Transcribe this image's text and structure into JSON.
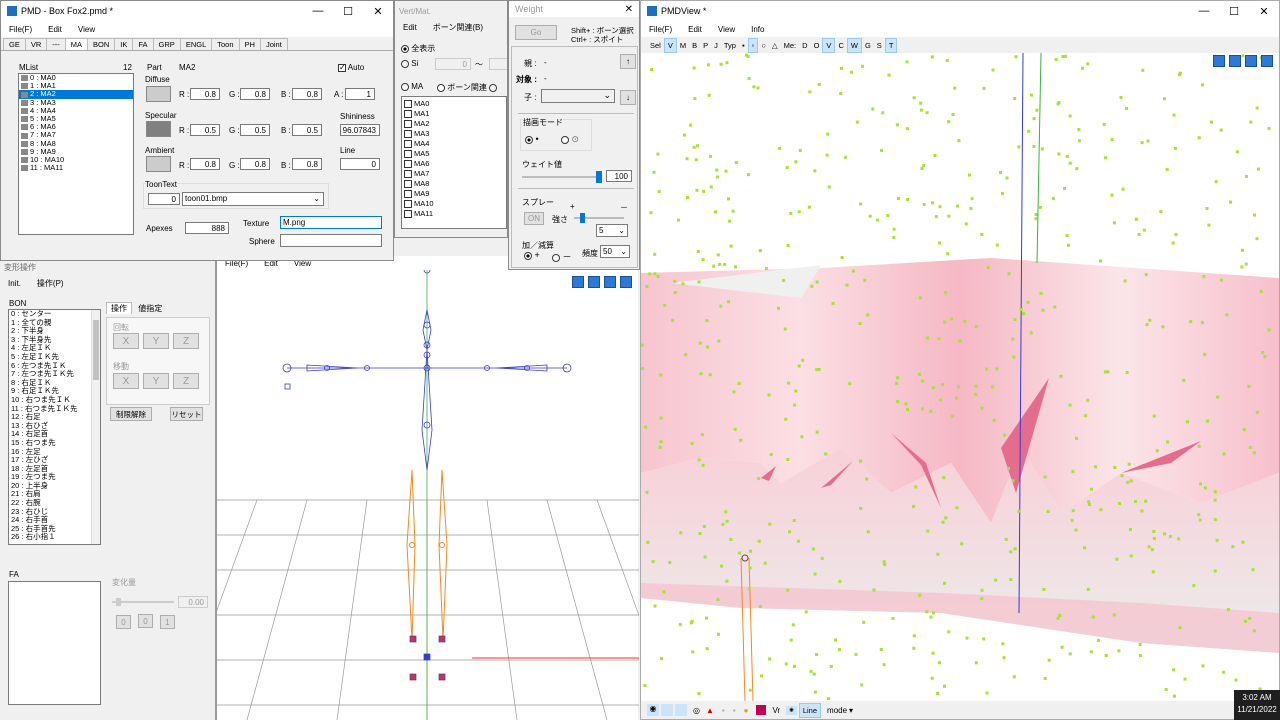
{
  "pmd": {
    "title": "PMD  - Box Fox2.pmd *",
    "menu": [
      "File(F)",
      "Edit",
      "View"
    ],
    "tabs": [
      "GE",
      "VR",
      "---",
      "MA",
      "BON",
      "IK",
      "FA",
      "GRP",
      "ENGL",
      "Toon",
      "PH",
      "Joint"
    ],
    "mlist_label": "MList",
    "mlist_count": "12",
    "mlist_items": [
      "0 : MA0",
      "1 : MA1",
      "2 : MA2",
      "3 : MA3",
      "4 : MA4",
      "5 : MA5",
      "6 : MA6",
      "7 : MA7",
      "8 : MA8",
      "9 : MA9",
      "10 : MA10",
      "11 : MA11"
    ],
    "part_label": "Part",
    "part_value": "MA2",
    "auto_label": "Auto",
    "diffuse": {
      "label": "Diffuse",
      "r": "0.8",
      "g": "0.8",
      "b": "0.8",
      "a_label": "A :",
      "a": "1",
      "color": "#cccccc"
    },
    "specular": {
      "label": "Specular",
      "r": "0.5",
      "g": "0.5",
      "b": "0.5",
      "color": "#808080"
    },
    "shininess": {
      "label": "Shininess",
      "value": "96.07843"
    },
    "ambient": {
      "label": "Ambient",
      "r": "0.8",
      "g": "0.8",
      "b": "0.8",
      "color": "#cccccc"
    },
    "line": {
      "label": "Line",
      "value": "0"
    },
    "r_label": "R :",
    "g_label": "G :",
    "b_label": "B :",
    "toontext": {
      "label": "ToonText",
      "index": "0",
      "file": "toon01.bmp"
    },
    "apexes": {
      "label": "Apexes",
      "value": "888"
    },
    "texture": {
      "label": "Texture",
      "value": "M.png"
    },
    "sphere": {
      "label": "Sphere",
      "value": ""
    }
  },
  "vert": {
    "title": "Vert/Mat.",
    "menu": [
      "Edit",
      "ボーン関連(B)"
    ],
    "show_all": "全表示",
    "si_label": "Si",
    "si_value": "0",
    "tilde": "～",
    "ma_label": "MA",
    "bone_label": "ボーン関連",
    "items": [
      "MA0",
      "MA1",
      "MA2",
      "MA3",
      "MA4",
      "MA5",
      "MA6",
      "MA7",
      "MA8",
      "MA9",
      "MA10",
      "MA11"
    ]
  },
  "weight": {
    "title": "Weight",
    "go": "Go",
    "hint1": "Shift+ : ボーン選択",
    "hint2": "Ctrl+ : スポイト",
    "parent_label": "親 :",
    "parent_value": "-",
    "target_label": "対象 :",
    "target_value": "-",
    "child_label": "子 :",
    "draw_mode": "描画モード",
    "weight_label": "ウェイト値",
    "weight_value": "100",
    "weight_fraction": 1.0,
    "spray": "スプレー",
    "spray_on": "ON",
    "strength": "強さ",
    "strength_value": "5",
    "plus": "+",
    "minus": "－",
    "addsub": "加／減算",
    "add": "+",
    "sub": "－",
    "freq": "頻度",
    "freq_value": "50"
  },
  "deform": {
    "title": "変形操作",
    "menu": [
      "Init.",
      "操作(P)"
    ],
    "bon_label": "BON",
    "bones": [
      "0 : センター",
      "1 : 全ての親",
      "2 : 下半身",
      "3 : 下半身先",
      "4 : 左足ＩＫ",
      "5 : 左足ＩＫ先",
      "6 : 左つま先ＩＫ",
      "7 : 左つま先ＩＫ先",
      "8 : 右足ＩＫ",
      "9 : 右足ＩＫ先",
      "10 : 右つま先ＩＫ",
      "11 : 右つま先ＩＫ先",
      "12 : 右足",
      "13 : 右ひざ",
      "14 : 右足首",
      "15 : 右つま先",
      "16 : 左足",
      "17 : 左ひざ",
      "18 : 左足首",
      "19 : 左つま先",
      "20 : 上半身",
      "21 : 右肩",
      "22 : 右腕",
      "23 : 右ひじ",
      "24 : 右手首",
      "25 : 右手首先",
      "26 : 右小指１"
    ],
    "op_tab": "操作",
    "val_tab": "値指定",
    "rotate": "回転",
    "move": "移動",
    "x": "X",
    "y": "Y",
    "z": "Z",
    "unlock": "制限解除",
    "reset": "リセット",
    "fa_label": "FA",
    "change_label": "変化量",
    "change_value": "0.00",
    "small_btns": [
      "0",
      "0",
      "1"
    ]
  },
  "midview": {
    "menu": [
      "File(F)",
      "Edit",
      "View"
    ]
  },
  "pmdview": {
    "title": "PMDView *",
    "menu": [
      "File(F)",
      "Edit",
      "View",
      "Info"
    ],
    "toolbar": [
      "Sel",
      "V",
      "M",
      "B",
      "P",
      "J",
      "Typ",
      "Me:",
      "D",
      "O",
      "V",
      "C",
      "W",
      "G",
      "S",
      "T"
    ],
    "status_vr": "Vr",
    "status_line": "Line",
    "status_mode": "mode"
  },
  "taskbar": {
    "time": "3:02 AM",
    "date": "11/21/2022"
  },
  "colors": {
    "accent": "#0078d7",
    "skin": "#f7c0cc",
    "point": "#a6e22e",
    "bone_blue": "#3a3acc",
    "bone_orange": "#f08a24"
  }
}
